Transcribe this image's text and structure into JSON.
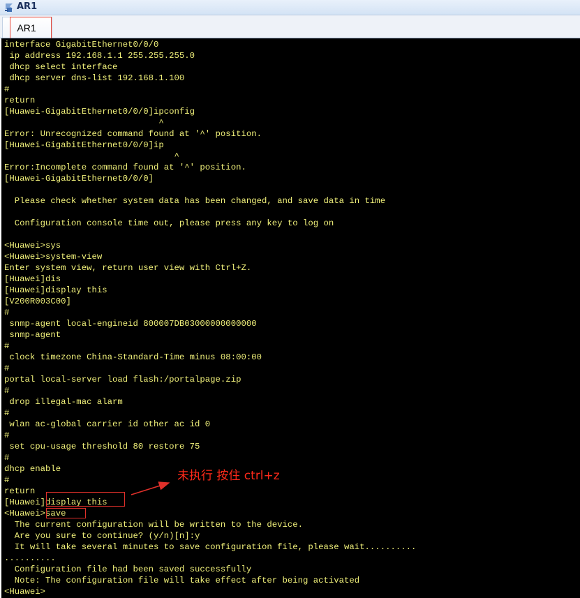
{
  "window": {
    "title": "AR1"
  },
  "tabs": [
    {
      "label": "AR1"
    }
  ],
  "terminal": {
    "lines": [
      "interface GigabitEthernet0/0/0",
      " ip address 192.168.1.1 255.255.255.0",
      " dhcp select interface",
      " dhcp server dns-list 192.168.1.100",
      "#",
      "return",
      "[Huawei-GigabitEthernet0/0/0]ipconfig",
      "                              ^",
      "Error: Unrecognized command found at '^' position.",
      "[Huawei-GigabitEthernet0/0/0]ip",
      "                                 ^",
      "Error:Incomplete command found at '^' position.",
      "[Huawei-GigabitEthernet0/0/0]",
      "",
      "  Please check whether system data has been changed, and save data in time",
      "",
      "  Configuration console time out, please press any key to log on",
      "",
      "<Huawei>sys",
      "<Huawei>system-view",
      "Enter system view, return user view with Ctrl+Z.",
      "[Huawei]dis",
      "[Huawei]display this",
      "[V200R003C00]",
      "#",
      " snmp-agent local-engineid 800007DB03000000000000",
      " snmp-agent",
      "#",
      " clock timezone China-Standard-Time minus 08:00:00",
      "#",
      "portal local-server load flash:/portalpage.zip",
      "#",
      " drop illegal-mac alarm",
      "#",
      " wlan ac-global carrier id other ac id 0",
      "#",
      " set cpu-usage threshold 80 restore 75",
      "#",
      "dhcp enable",
      "#",
      "return",
      "[Huawei]display this",
      "<Huawei>save",
      "  The current configuration will be written to the device.",
      "  Are you sure to continue? (y/n)[n]:y",
      "  It will take several minutes to save configuration file, please wait..........",
      "..........",
      "  Configuration file had been saved successfully",
      "  Note: The configuration file will take effect after being activated",
      "<Huawei>"
    ]
  },
  "annotation": {
    "text": "未执行 按住 ctrl+z",
    "color": "#ff2a1a"
  },
  "colors": {
    "terminal_bg": "#000000",
    "terminal_fg": "#f0f07a",
    "highlight": "#e0302a"
  }
}
